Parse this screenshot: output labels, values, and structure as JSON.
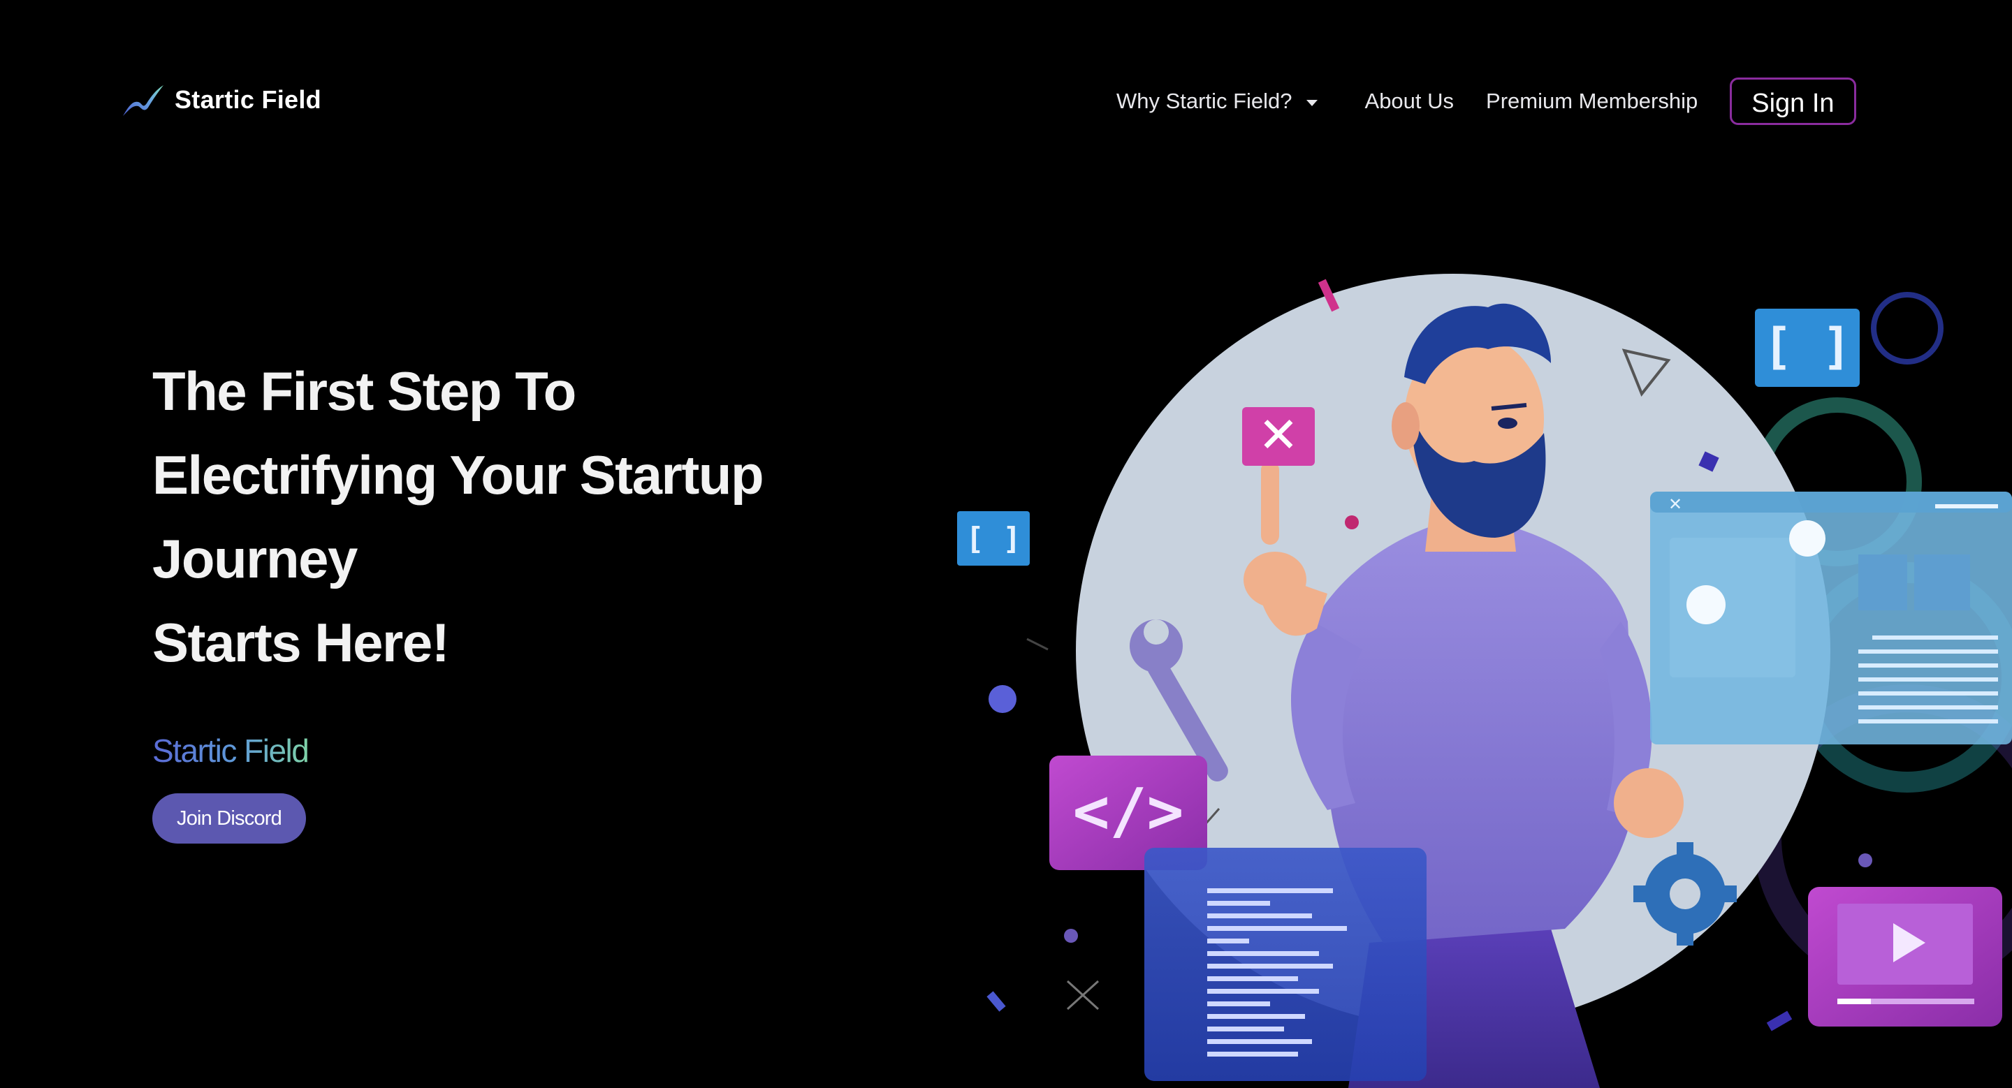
{
  "nav": {
    "brand_name": "Startic Field",
    "links": {
      "why": "Why Startic Field?",
      "about": "About Us",
      "premium": "Premium Membership"
    },
    "signin_label": "Sign In"
  },
  "hero": {
    "title_lines": [
      "The First Step To",
      "Electrifying Your Startup",
      "Journey",
      "Starts Here!"
    ],
    "brand_text": "Startic Field",
    "discord_label": "Join Discord"
  },
  "colors": {
    "background": "#000000",
    "signin_border": "#8a2c9e",
    "discord_button": "#5c58b0",
    "brand_gradient": [
      "#5a6ad6",
      "#5f9bd8",
      "#7fd3a8"
    ]
  },
  "icons": {
    "logo": "lightning-wave-icon",
    "dropdown": "caret-down-icon"
  }
}
